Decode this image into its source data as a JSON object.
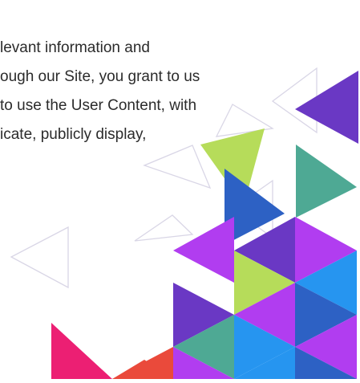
{
  "text": {
    "lines": [
      "levant information and",
      "ough our Site, you grant to us",
      "to use the User Content, with",
      "icate, publicly display,"
    ]
  },
  "decoration": {
    "icon": "geometric-triangle-pattern",
    "colors": {
      "purple": "#6a38c4",
      "violet": "#b13df0",
      "lime": "#b6dc5a",
      "teal": "#4ea994",
      "blue": "#2d61c4",
      "skyblue": "#2695f0",
      "pink": "#ec1f73",
      "orange": "#ea4a3b",
      "outline": "#d9d6e6"
    }
  }
}
